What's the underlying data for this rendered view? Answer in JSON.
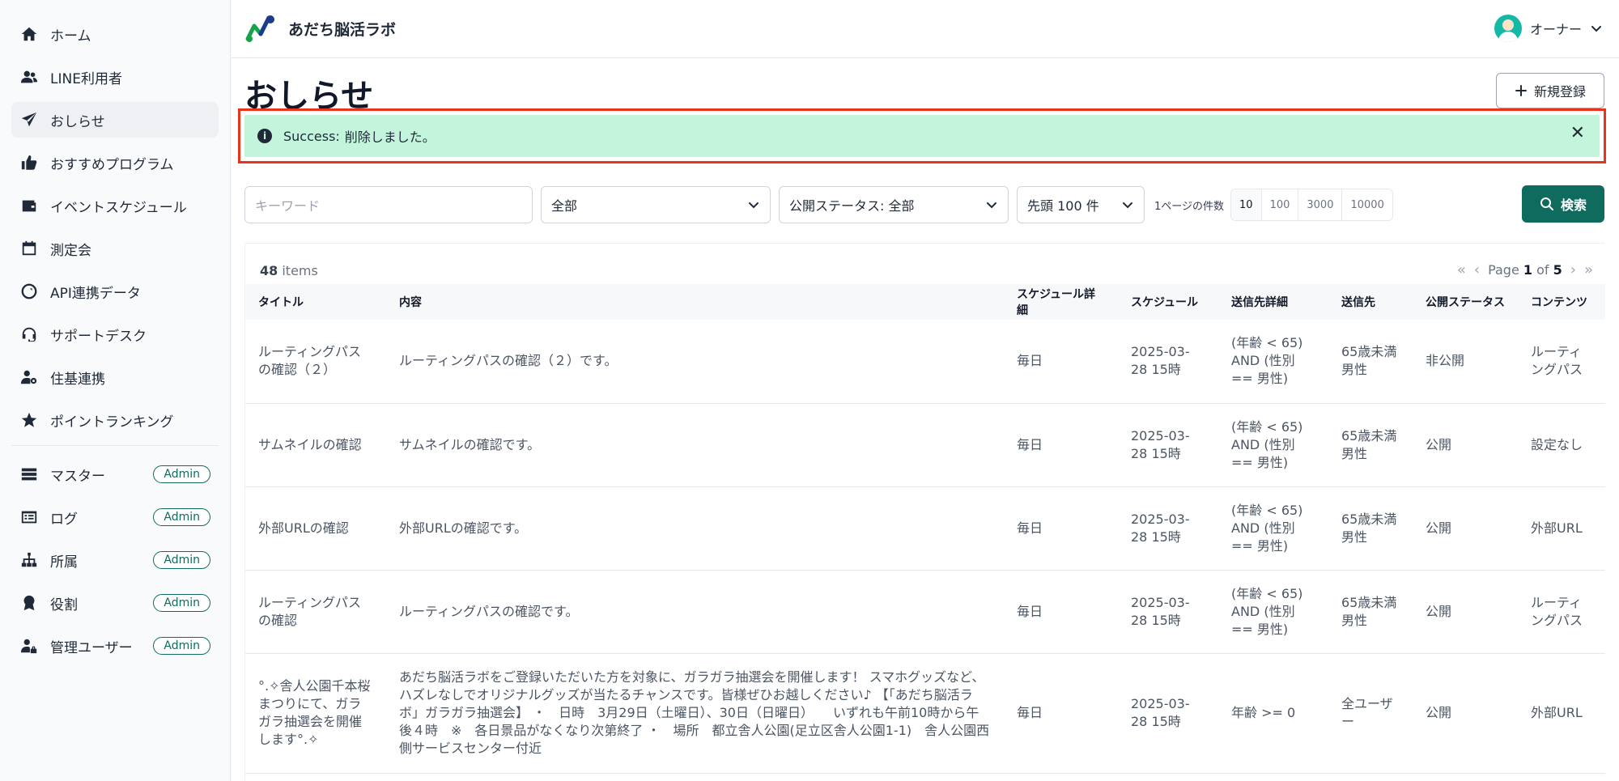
{
  "app": {
    "title": "あだち脳活ラボ"
  },
  "user": {
    "name": "オーナー"
  },
  "sidebar": {
    "items": [
      {
        "label": "ホーム",
        "icon": "home-icon"
      },
      {
        "label": "LINE利用者",
        "icon": "users-icon"
      },
      {
        "label": "おしらせ",
        "icon": "paper-plane-icon",
        "active": true
      },
      {
        "label": "おすすめプログラム",
        "icon": "thumbs-up-icon"
      },
      {
        "label": "イベントスケジュール",
        "icon": "wallet-icon"
      },
      {
        "label": "測定会",
        "icon": "calendar-icon"
      },
      {
        "label": "API連携データ",
        "icon": "api-icon"
      },
      {
        "label": "サポートデスク",
        "icon": "headset-icon"
      },
      {
        "label": "住基連携",
        "icon": "user-gear-icon"
      },
      {
        "label": "ポイントランキング",
        "icon": "star-icon"
      }
    ],
    "admin_items": [
      {
        "label": "マスター",
        "icon": "master-list-icon",
        "badge": "Admin"
      },
      {
        "label": "ログ",
        "icon": "log-icon",
        "badge": "Admin"
      },
      {
        "label": "所属",
        "icon": "org-chart-icon",
        "badge": "Admin"
      },
      {
        "label": "役割",
        "icon": "award-icon",
        "badge": "Admin"
      },
      {
        "label": "管理ユーザー",
        "icon": "user-lock-icon",
        "badge": "Admin"
      }
    ]
  },
  "page": {
    "title": "おしらせ",
    "new_button": "新規登録"
  },
  "alert": {
    "prefix": "Success:",
    "message": "削除しました。"
  },
  "filters": {
    "keyword_placeholder": "キーワード",
    "category": "全部",
    "status": "公開ステータス: 全部",
    "limit": "先頭 100 件",
    "per_page_label": "1ページの件数",
    "per_page_options": [
      "10",
      "100",
      "3000",
      "10000"
    ],
    "per_page_selected": "10",
    "search_button": "検索"
  },
  "table": {
    "count": "48",
    "count_suffix": "items",
    "pager": {
      "prefix": "Page",
      "current": "1",
      "of": "of",
      "total": "5"
    },
    "columns": [
      "タイトル",
      "内容",
      "スケジュール詳細",
      "スケジュール",
      "送信先詳細",
      "送信先",
      "公開ステータス",
      "コンテンツ"
    ],
    "rows": [
      [
        "ルーティングパスの確認（２）",
        "ルーティングパスの確認（２）です。",
        "毎日",
        "2025-03-28 15時",
        "(年齢 < 65) AND (性別 == 男性)",
        "65歳未満男性",
        "非公開",
        "ルーティングパス"
      ],
      [
        "サムネイルの確認",
        "サムネイルの確認です。",
        "毎日",
        "2025-03-28 15時",
        "(年齢 < 65) AND (性別 == 男性)",
        "65歳未満男性",
        "公開",
        "設定なし"
      ],
      [
        "外部URLの確認",
        "外部URLの確認です。",
        "毎日",
        "2025-03-28 15時",
        "(年齢 < 65) AND (性別 == 男性)",
        "65歳未満男性",
        "公開",
        "外部URL"
      ],
      [
        "ルーティングパスの確認",
        "ルーティングパスの確認です。",
        "毎日",
        "2025-03-28 15時",
        "(年齢 < 65) AND (性別 == 男性)",
        "65歳未満男性",
        "公開",
        "ルーティングパス"
      ],
      [
        "°.✧舎人公園千本桜まつりにて、ガラガラ抽選会を開催します°.✧",
        "あだち脳活ラボをご登録いただいた方を対象に、ガラガラ抽選会を開催します！ スマホグッズなど、ハズレなしでオリジナルグッズが当たるチャンスです。皆様ぜひお越しください♪ 【「あだち脳活ラボ」ガラガラ抽選会】 ・　日時　3月29日（土曜日）、30日（日曜日）　　いずれも午前10時から午後４時　※　各日景品がなくなり次第終了 ・　場所　都立舎人公園(足立区舎人公園1-1)　舎人公園西側サービスセンター付近",
        "毎日",
        "2025-03-28 15時",
        "年齢 >= 0",
        "全ユーザー",
        "公開",
        "外部URL"
      ]
    ]
  },
  "colors": {
    "accent": "#0f6b5e",
    "alert_bg": "#c2f5dc",
    "highlight_border": "#e8341c"
  }
}
